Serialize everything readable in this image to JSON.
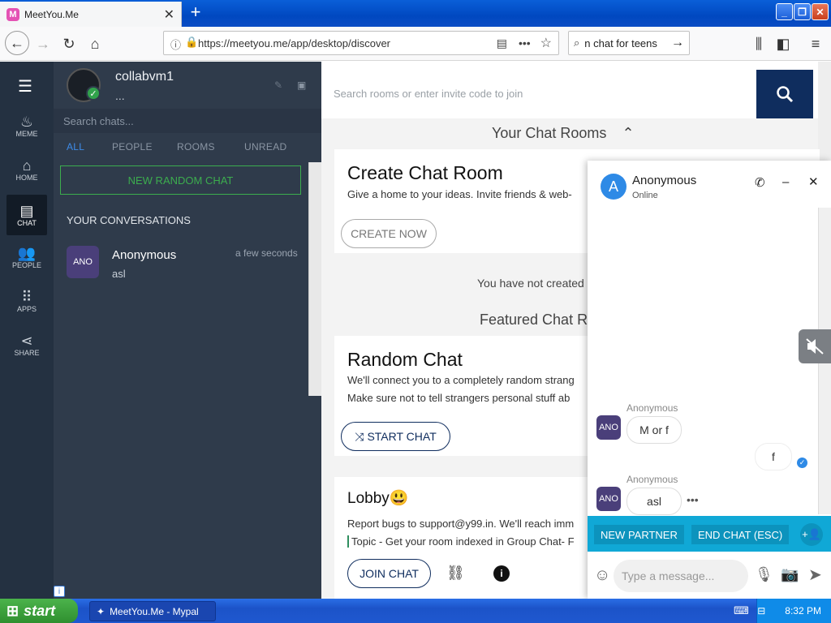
{
  "browser": {
    "tab_title": "MeetYou.Me",
    "tab_favicon": "M",
    "url": "https://meetyou.me/app/desktop/discover",
    "search_text": "n chat for teens"
  },
  "rail": {
    "items": [
      {
        "icon": "flame-icon",
        "label": "MEME"
      },
      {
        "icon": "home-icon",
        "label": "HOME"
      },
      {
        "icon": "chat-icon",
        "label": "CHAT"
      },
      {
        "icon": "people-icon",
        "label": "PEOPLE"
      },
      {
        "icon": "apps-icon",
        "label": "APPS"
      },
      {
        "icon": "share-icon",
        "label": "SHARE"
      }
    ]
  },
  "sidebar": {
    "username": "collabvm1",
    "status": "...",
    "search_placeholder": "Search chats...",
    "filters": [
      "ALL",
      "PEOPLE",
      "ROOMS",
      "UNREAD"
    ],
    "new_random_chat": "NEW RANDOM CHAT",
    "your_conversations": "YOUR CONVERSATIONS",
    "conversation": {
      "avatar": "ANO",
      "name": "Anonymous",
      "last_message": "asl",
      "time": "a few seconds"
    }
  },
  "main": {
    "search_placeholder": "Search rooms or enter invite code to join",
    "your_chat_rooms": "Your Chat Rooms",
    "create_title": "Create Chat Room",
    "create_sub": "Give a home to your ideas. Invite friends & web-",
    "create_now": "CREATE NOW",
    "not_created": "You have not created",
    "featured": "Featured Chat Ro",
    "random_title": "Random Chat",
    "random_sub1": "We'll connect you to a completely random strang",
    "random_sub2": "Make sure not to tell strangers personal stuff ab",
    "start_chat": "START CHAT",
    "lobby_title": "Lobby😃",
    "lobby_sub": "Report bugs to support@y99.in. We'll reach imm",
    "lobby_topic": "Topic - Get your room indexed in Group Chat- F",
    "join_chat": "JOIN CHAT"
  },
  "popup": {
    "avatar": "A",
    "name": "Anonymous",
    "status": "Online",
    "messages": [
      {
        "sender": "Anonymous",
        "avatar": "ANO",
        "text": "M or f",
        "side": "left"
      },
      {
        "sender": "",
        "avatar": "",
        "text": "f",
        "side": "right"
      },
      {
        "sender": "Anonymous",
        "avatar": "ANO",
        "text": "asl",
        "side": "left"
      }
    ],
    "new_partner": "NEW PARTNER",
    "end_chat": "END CHAT (ESC)",
    "input_placeholder": "Type a message..."
  },
  "taskbar": {
    "start": "start",
    "task": "MeetYou.Me - Mypal",
    "clock": "8:32 PM"
  },
  "colors": {
    "rail_bg": "#243141",
    "panel_bg": "#2f3b4b",
    "accent_green": "#3cad4e",
    "search_btn": "#0f2d5e",
    "popup_action_bar": "#10a8d6"
  }
}
